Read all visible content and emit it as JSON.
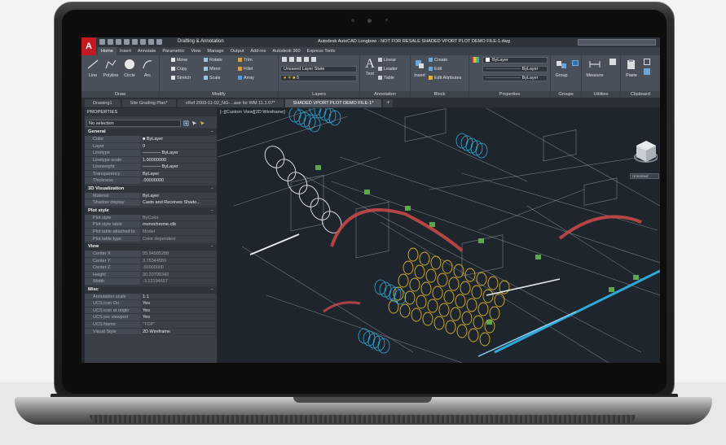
{
  "app": {
    "logo": "A",
    "workspace": "Drafting & Annotation",
    "window_title": "Autodesk AutoCAD Longbow - NOT FOR RESALE    SHADED VPORT PLOT DEMO FILE-1.dwg"
  },
  "ribbon_tabs": [
    "Home",
    "Insert",
    "Annotate",
    "Parametric",
    "View",
    "Manage",
    "Output",
    "Add-ins",
    "Autodesk 360",
    "Express Tools"
  ],
  "ribbon": {
    "draw": {
      "title": "Draw",
      "line": "Line",
      "polyline": "Polyline",
      "circle": "Circle",
      "arc": "Arc"
    },
    "modify": {
      "title": "Modify",
      "move": "Move",
      "rotate": "Rotate",
      "trim": "Trim",
      "copy": "Copy",
      "mirror": "Mirror",
      "fillet": "Fillet",
      "stretch": "Stretch",
      "scale": "Scale",
      "array": "Array"
    },
    "layers": {
      "title": "Layers",
      "layer_state": "Unsaved Layer State",
      "current_layer": "0"
    },
    "annotation": {
      "title": "Annotation",
      "text": "Text",
      "linear": "Linear",
      "leader": "Leader",
      "table": "Table"
    },
    "block": {
      "title": "Block",
      "insert": "Insert",
      "create": "Create",
      "edit": "Edit",
      "edit_attributes": "Edit Attributes"
    },
    "properties": {
      "title": "Properties",
      "color": "ByLayer",
      "linetype": "ByLayer",
      "lineweight": "ByLayer"
    },
    "groups": {
      "title": "Groups",
      "group": "Group"
    },
    "utilities": {
      "title": "Utilities",
      "measure": "Measure"
    },
    "clipboard": {
      "title": "Clipboard",
      "paste": "Paste"
    }
  },
  "doc_tabs": [
    "Drawing1",
    "Site Grading Plan*",
    "xRef 2003-11-02_NG-...ase for WM 11.1.07*",
    "SHADED VPORT PLOT DEMO FILE-1*"
  ],
  "doc_tab_add": "+",
  "properties": {
    "title": "PROPERTIES",
    "selection": "No selection",
    "sections": [
      {
        "name": "General",
        "rows": [
          {
            "k": "Color",
            "v": "■ ByLayer"
          },
          {
            "k": "Layer",
            "v": "0"
          },
          {
            "k": "Linetype",
            "v": "———— ByLayer"
          },
          {
            "k": "Linetype scale",
            "v": "1.00000000"
          },
          {
            "k": "Lineweight",
            "v": "———— ByLayer"
          },
          {
            "k": "Transparency",
            "v": "ByLayer"
          },
          {
            "k": "Thickness",
            "v": ".00000000"
          }
        ]
      },
      {
        "name": "3D Visualization",
        "rows": [
          {
            "k": "Material",
            "v": "ByLayer"
          },
          {
            "k": "Shadow display",
            "v": "Casts and Receives Shado..."
          }
        ]
      },
      {
        "name": "Plot style",
        "rows": [
          {
            "k": "Plot style",
            "v": "ByColor",
            "dim": true
          },
          {
            "k": "Plot style table",
            "v": "monochrome.ctb"
          },
          {
            "k": "Plot table attached to",
            "v": "Model",
            "dim": true
          },
          {
            "k": "Plot table type",
            "v": "Color dependent",
            "dim": true
          }
        ]
      },
      {
        "name": "View",
        "rows": [
          {
            "k": "Center X",
            "v": "55.94585288",
            "dim": true
          },
          {
            "k": "Center Y",
            "v": "3.75344559",
            "dim": true
          },
          {
            "k": "Center Z",
            "v": ".00000000",
            "dim": true
          },
          {
            "k": "Height",
            "v": "30.20799342",
            "dim": true
          },
          {
            "k": "Width",
            "v": "-3.12194657",
            "dim": true
          }
        ]
      },
      {
        "name": "Misc",
        "rows": [
          {
            "k": "Annotation scale",
            "v": "1:1"
          },
          {
            "k": "UCS icon On",
            "v": "Yes"
          },
          {
            "k": "UCS icon at origin",
            "v": "Yes"
          },
          {
            "k": "UCS per viewport",
            "v": "Yes"
          },
          {
            "k": "UCS Name",
            "v": "\"TOP\"",
            "dim": true
          },
          {
            "k": "Visual Style",
            "v": "2D Wireframe"
          }
        ]
      }
    ]
  },
  "viewport": {
    "label": "[–][Custom View][2D Wireframe]",
    "viewcube_unnamed": "Unnamed"
  },
  "colors": {
    "accent": "#c4191f",
    "canvas": "#1f252d",
    "panel": "#3b4048",
    "blue": "#2fa8d8",
    "yellow": "#d8b22a",
    "green": "#62b84a",
    "red": "#d04a4a"
  }
}
